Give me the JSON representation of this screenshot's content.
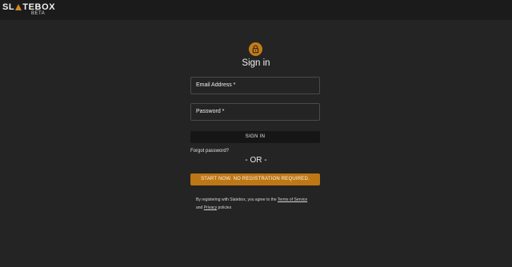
{
  "header": {
    "logo_before": "SL",
    "logo_after": "TEBOX",
    "logo_beta": "BETA",
    "accent_color": "#d4891c"
  },
  "form": {
    "icon": "lock-icon",
    "title": "Sign in",
    "email_placeholder": "Email Address *",
    "password_placeholder": "Password *",
    "signin_label": "SIGN IN",
    "forgot_label": "Forgot password?",
    "or_label": "- OR -",
    "start_label": "START NOW. NO REGISTRATION REQUIRED.",
    "start_color": "#bd7715"
  },
  "legal": {
    "prefix": "By registering with Slatebox, you agree to the ",
    "terms_link": "Terms of Service",
    "and": "and ",
    "privacy_link": "Privacy",
    "suffix": " policies"
  }
}
